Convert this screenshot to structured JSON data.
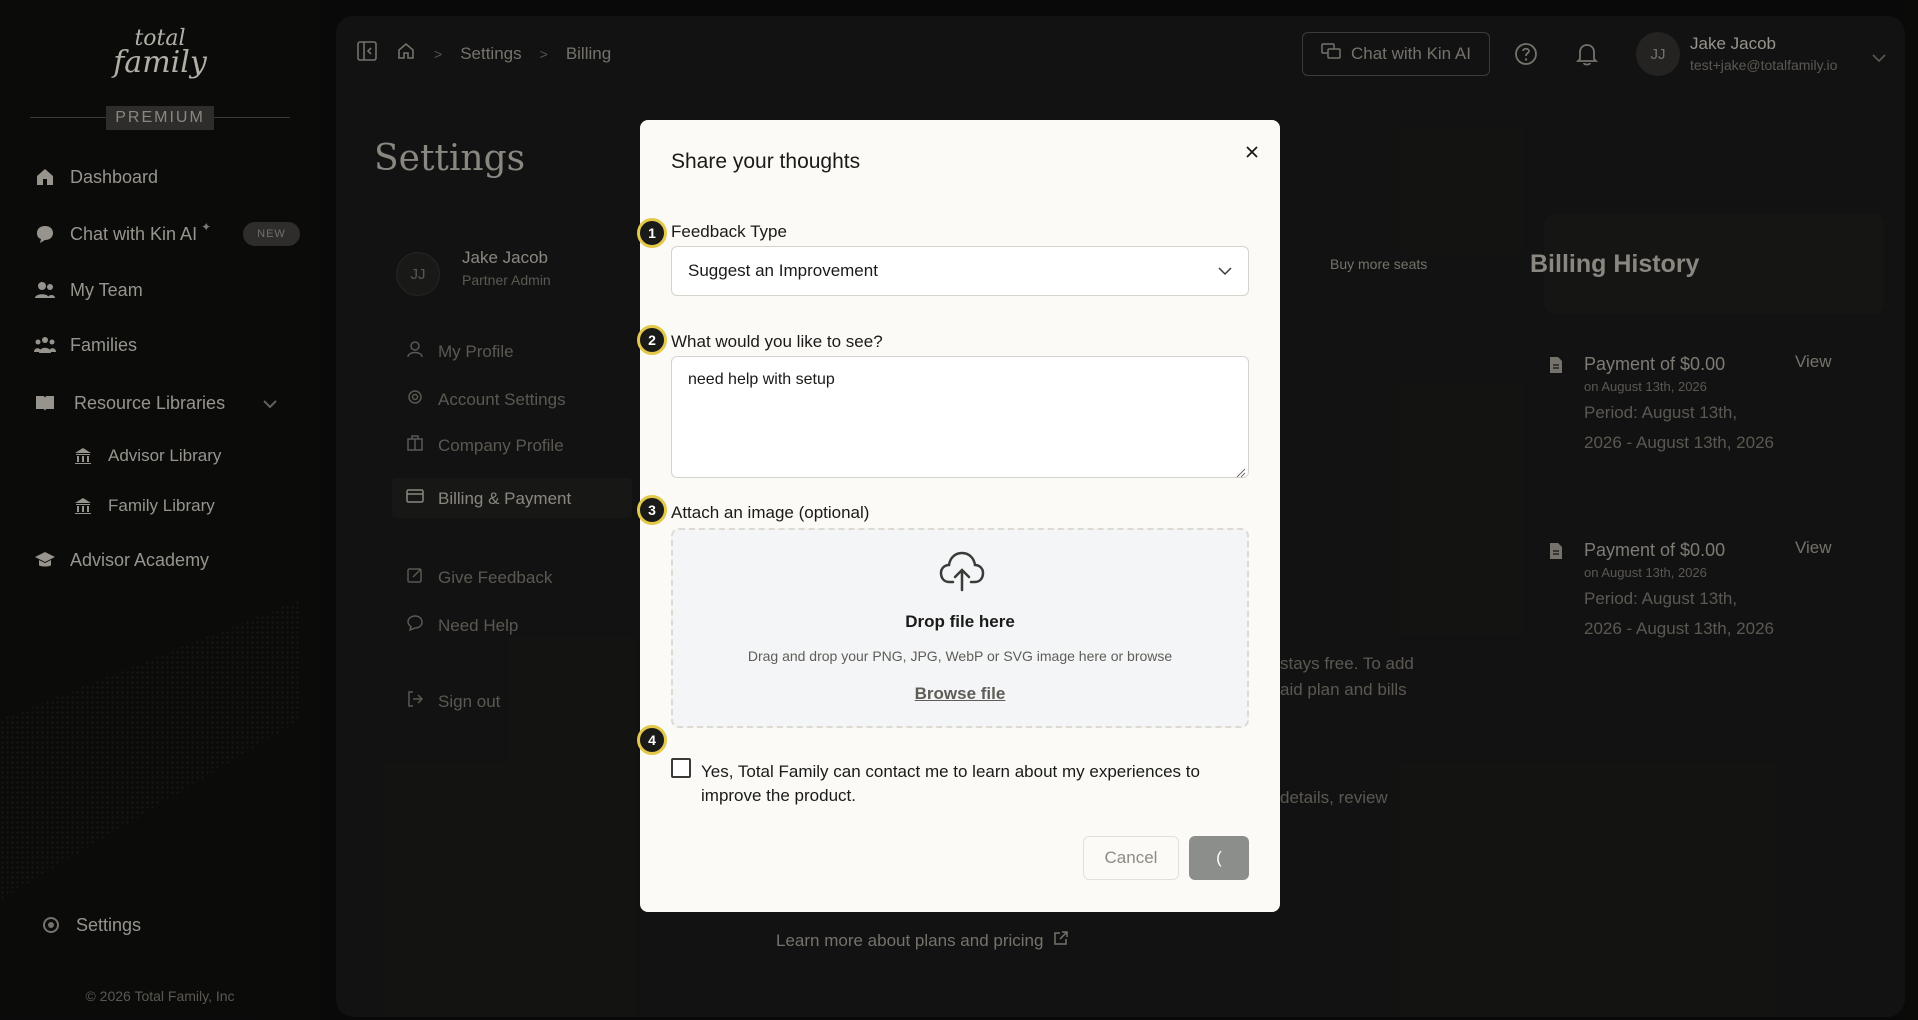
{
  "brand": {
    "logo_line1": "total",
    "logo_line2": "family",
    "tier": "PREMIUM"
  },
  "sidebar": {
    "items": [
      {
        "label": "Dashboard",
        "icon": "home-icon"
      },
      {
        "label": "Chat with Kin AI",
        "icon": "chat-bubble-icon",
        "badge": "NEW"
      },
      {
        "label": "My Team",
        "icon": "team-icon"
      },
      {
        "label": "Families",
        "icon": "families-icon"
      },
      {
        "label": "Resource Libraries",
        "icon": "book-icon"
      },
      {
        "label": "Advisor Library",
        "icon": "library-icon"
      },
      {
        "label": "Family Library",
        "icon": "library-icon"
      },
      {
        "label": "Advisor Academy",
        "icon": "graduation-cap-icon"
      }
    ],
    "settings_label": "Settings",
    "copyright": "© 2026 Total Family, Inc"
  },
  "topbar": {
    "breadcrumbs": [
      "Settings",
      "Billing"
    ],
    "chat_button": "Chat with Kin AI",
    "user": {
      "initials": "JJ",
      "name": "Jake Jacob",
      "email": "test+jake@totalfamily.io"
    }
  },
  "settings_page": {
    "title": "Settings",
    "profile": {
      "initials": "JJ",
      "name": "Jake Jacob",
      "role": "Partner Admin"
    },
    "menu": [
      "My Profile",
      "Account Settings",
      "Company Profile",
      "Billing & Payment",
      "Give Feedback",
      "Need Help",
      "Sign out"
    ],
    "buy_more_seats": "Buy more seats",
    "billing_history_title": "Billing History",
    "payments": [
      {
        "amount": "Payment of $0.00",
        "date": "on August 13th, 2026",
        "period": "Period: August 13th, 2026 - August 13th, 2026",
        "action": "View"
      },
      {
        "amount": "Payment of $0.00",
        "date": "on August 13th, 2026",
        "period": "Period: August 13th, 2026 - August 13th, 2026",
        "action": "View"
      }
    ],
    "bg_text_1": "stays free. To add",
    "bg_text_2": "aid plan and bills",
    "bg_text_3": "details, review",
    "learn_more": "Learn more about plans and pricing"
  },
  "modal": {
    "title": "Share your thoughts",
    "steps": [
      "1",
      "2",
      "3",
      "4"
    ],
    "feedback_type_label": "Feedback Type",
    "feedback_type_value": "Suggest an Improvement",
    "textarea_label": "What would you like to see?",
    "textarea_value": "need help with setup",
    "attach_label": "Attach an image (optional)",
    "drop_title": "Drop file here",
    "drop_sub": "Drag and drop your PNG, JPG, WebP or SVG image here or browse",
    "browse": "Browse file",
    "consent": "Yes, Total Family can contact me to learn about my experiences to improve the product.",
    "cancel": "Cancel",
    "submit": "("
  }
}
